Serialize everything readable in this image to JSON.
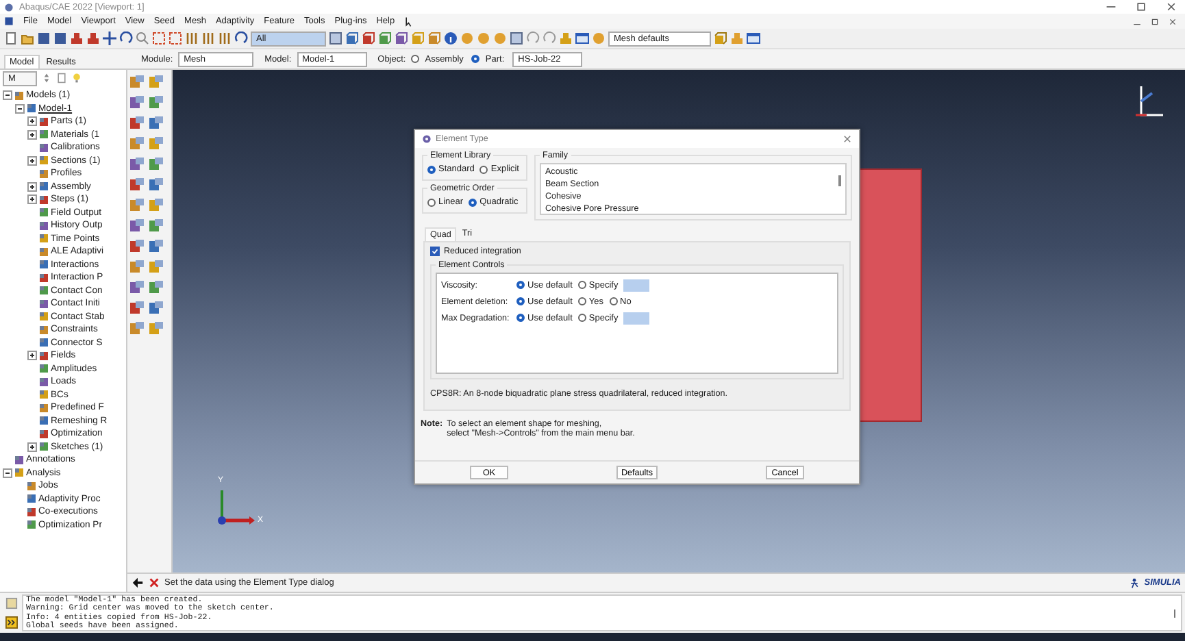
{
  "window": {
    "title": "Abaqus/CAE 2022 [Viewport: 1]"
  },
  "menu": [
    "File",
    "Model",
    "Viewport",
    "View",
    "Seed",
    "Mesh",
    "Adaptivity",
    "Feature",
    "Tools",
    "Plug-ins",
    "Help"
  ],
  "toolbar": {
    "selection_filter": "All",
    "mesh_defaults": "Mesh defaults"
  },
  "tabs": [
    {
      "label": "Model",
      "selected": true
    },
    {
      "label": "Results",
      "selected": false
    }
  ],
  "context": {
    "module_label": "Module:",
    "module": "Mesh",
    "model_label": "Model:",
    "model": "Model-1",
    "object_label": "Object:",
    "objects": [
      {
        "label": "Assembly",
        "selected": false
      },
      {
        "label": "Part:",
        "selected": true
      }
    ],
    "part": "HS-Job-22"
  },
  "tree_filter": "M",
  "tree": [
    {
      "label": "Models (1)",
      "expanded": true,
      "children": [
        {
          "label": "Model-1",
          "expanded": true,
          "children": [
            {
              "label": "Parts (1)",
              "expanded": false
            },
            {
              "label": "Materials (1",
              "expanded": false
            },
            {
              "label": "Calibrations"
            },
            {
              "label": "Sections (1)",
              "expanded": false
            },
            {
              "label": "Profiles"
            },
            {
              "label": "Assembly",
              "expanded": false
            },
            {
              "label": "Steps (1)",
              "expanded": false
            },
            {
              "label": "Field Output"
            },
            {
              "label": "History Outp"
            },
            {
              "label": "Time Points"
            },
            {
              "label": "ALE Adaptivi"
            },
            {
              "label": "Interactions"
            },
            {
              "label": "Interaction P"
            },
            {
              "label": "Contact Con"
            },
            {
              "label": "Contact Initi"
            },
            {
              "label": "Contact Stab"
            },
            {
              "label": "Constraints"
            },
            {
              "label": "Connector S"
            },
            {
              "label": "Fields",
              "expanded": false
            },
            {
              "label": "Amplitudes"
            },
            {
              "label": "Loads"
            },
            {
              "label": "BCs"
            },
            {
              "label": "Predefined F"
            },
            {
              "label": "Remeshing R"
            },
            {
              "label": "Optimization"
            },
            {
              "label": "Sketches (1)",
              "expanded": false
            }
          ]
        }
      ]
    },
    {
      "label": "Annotations"
    },
    {
      "label": "Analysis",
      "expanded": true,
      "children": [
        {
          "label": "Jobs"
        },
        {
          "label": "Adaptivity Proc"
        },
        {
          "label": "Co-executions"
        },
        {
          "label": "Optimization Pr"
        }
      ]
    }
  ],
  "dialog": {
    "title": "Element Type",
    "library": {
      "label": "Element Library",
      "options": [
        {
          "label": "Standard",
          "selected": true
        },
        {
          "label": "Explicit",
          "selected": false
        }
      ]
    },
    "order": {
      "label": "Geometric Order",
      "options": [
        {
          "label": "Linear",
          "selected": false
        },
        {
          "label": "Quadratic",
          "selected": true
        }
      ]
    },
    "family": {
      "label": "Family",
      "items": [
        "Acoustic",
        "Beam Section",
        "Cohesive",
        "Cohesive Pore Pressure"
      ]
    },
    "tabs": [
      {
        "label": "Quad",
        "selected": true
      },
      {
        "label": "Tri",
        "selected": false
      }
    ],
    "reduced_integration": {
      "label": "Reduced integration",
      "checked": true
    },
    "controls": {
      "label": "Element Controls",
      "rows": [
        {
          "label": "Viscosity:",
          "kind": "specify",
          "options": [
            {
              "label": "Use default",
              "selected": true
            },
            {
              "label": "Specify",
              "selected": false
            }
          ]
        },
        {
          "label": "Element deletion:",
          "kind": "choice",
          "options": [
            {
              "label": "Use default",
              "selected": true
            },
            {
              "label": "Yes",
              "selected": false
            },
            {
              "label": "No",
              "selected": false
            }
          ]
        },
        {
          "label": "Max Degradation:",
          "kind": "specify",
          "options": [
            {
              "label": "Use default",
              "selected": true
            },
            {
              "label": "Specify",
              "selected": false
            }
          ]
        }
      ]
    },
    "description": "CPS8R:  An 8-node biquadratic plane stress quadrilateral, reduced integration.",
    "note": {
      "label": "Note:",
      "lines": [
        "To select an element shape for meshing,",
        "select \"Mesh->Controls\" from the main menu bar."
      ]
    },
    "buttons": [
      "OK",
      "Defaults",
      "Cancel"
    ]
  },
  "viewport": {
    "axis_labels": [
      "Y",
      "X"
    ]
  },
  "prompt": "Set the data using the Element Type dialog",
  "brand": "SIMULIA",
  "messages": [
    "The model \"Model-1\" has been created.",
    "Warning: Grid center was moved to the sketch center.",
    "Info: 4 entities copied from HS-Job-22.",
    "Global seeds have been assigned."
  ]
}
